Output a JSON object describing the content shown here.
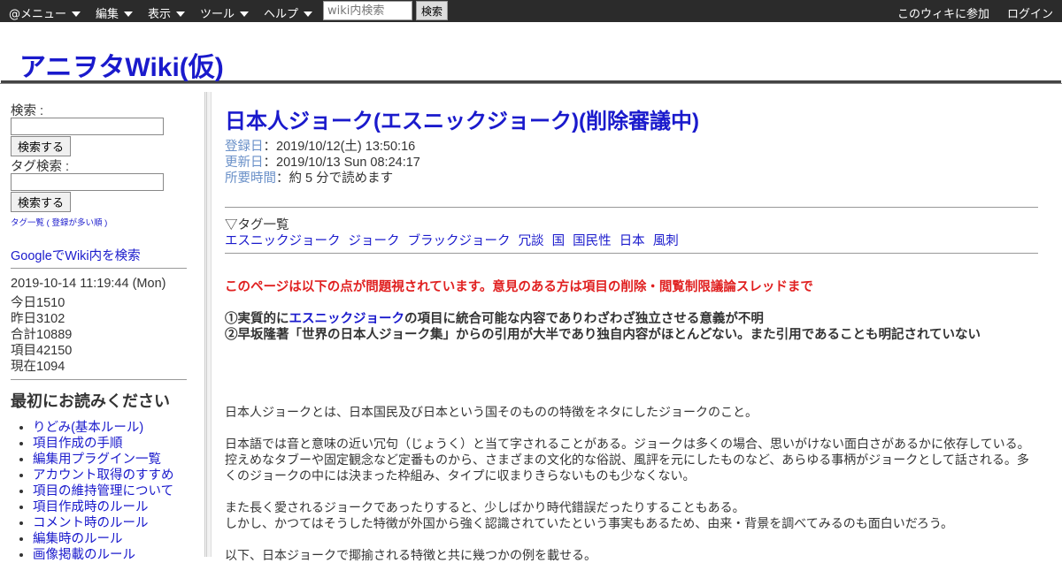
{
  "topbar": {
    "menus": [
      "@メニュー",
      "編集",
      "表示",
      "ツール",
      "ヘルプ"
    ],
    "search_placeholder": "wiki内検索",
    "search_button": "検索",
    "join": "このウィキに参加",
    "login": "ログイン"
  },
  "site": {
    "title": "アニヲタWiki(仮)"
  },
  "sidebar": {
    "search_label": "検索 :",
    "search_button": "検索する",
    "tag_search_label": "タグ検索 :",
    "tag_search_button": "検索する",
    "tag_list_link": "タグ一覧",
    "tag_list_paren_open": "(",
    "tag_list_sort": "登録が多い順",
    "tag_list_paren_close": ")",
    "google_search": "GoogleでWiki内を検索",
    "stats": {
      "datetime": "2019-10-14 11:19:44 (Mon)",
      "today": "今日1510",
      "yesterday": "昨日3102",
      "total": "合計10889",
      "items": "項目42150",
      "current": "現在1094"
    },
    "first_read_heading": "最初にお読みください",
    "first_read_items": [
      "りどみ(基本ルール)",
      "項目作成の手順",
      "編集用プラグイン一覧",
      "アカウント取得のすすめ",
      "項目の維持管理について",
      "項目作成時のルール",
      "コメント時のルール",
      "編集時のルール",
      "画像掲載のルール"
    ]
  },
  "page": {
    "title": "日本人ジョーク(エスニックジョーク)(削除審議中)",
    "registered_label": "登録日",
    "registered_value": "：2019/10/12(土) 13:50:16",
    "updated_label": "更新日",
    "updated_value": "：2019/10/13 Sun 08:24:17",
    "reading_label": "所要時間",
    "reading_value": "：約 5 分で読めます",
    "tags_heading": "▽タグ一覧",
    "tags": [
      "エスニックジョーク",
      "ジョーク",
      "ブラックジョーク",
      "冗談",
      "国",
      "国民性",
      "日本",
      "風刺"
    ],
    "warning": "このページは以下の点が問題視されています。意見のある方は項目の削除・閲覧制限議論スレッドまで",
    "issue1_prefix": "①実質的に",
    "issue1_link": "エスニックジョーク",
    "issue1_suffix": "の項目に統合可能な内容でありわざわざ独立させる意義が不明",
    "issue2": "②早坂隆著「世界の日本人ジョーク集」からの引用が大半であり独自内容がほとんどない。また引用であることも明記されていない",
    "para1": "日本人ジョークとは、日本国民及び日本という国そのものの特徴をネタにしたジョークのこと。",
    "para2": "日本語では音と意味の近い冗句（じょうく）と当て字されることがある。ジョークは多くの場合、思いがけない面白さがあるかに依存している。控えめなタブーや固定観念など定番ものから、さまざまの文化的な俗説、風評を元にしたものなど、あらゆる事柄がジョークとして話される。多くのジョークの中には決まった枠組み、タイプに収まりきらないものも少なくない。",
    "para3a": "また長く愛されるジョークであったりすると、少しばかり時代錯誤だったりすることもある。",
    "para3b": "しかし、かつてはそうした特徴が外国から強く認識されていたという事実もあるため、由来・背景を調べてみるのも面白いだろう。",
    "para4": "以下、日本ジョークで揶揄される特徴と共に幾つかの例を載せる。"
  }
}
